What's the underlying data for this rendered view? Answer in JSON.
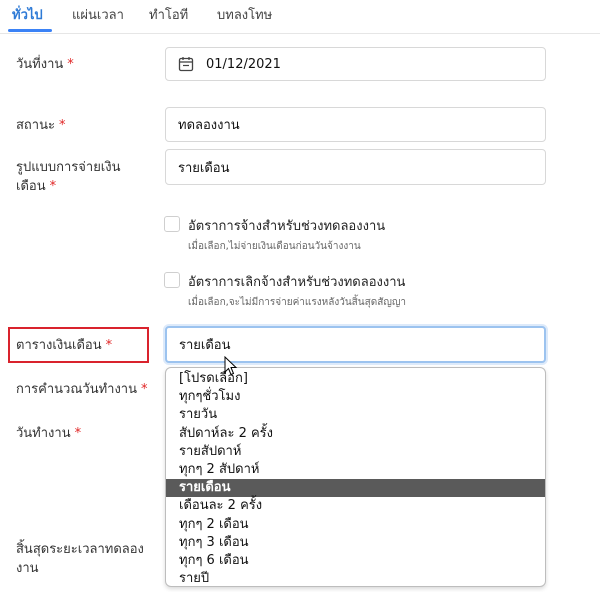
{
  "tabs": [
    {
      "label": "ทั่วไป",
      "active": true
    },
    {
      "label": "แผ่นเวลา",
      "active": false
    },
    {
      "label": "ทำโอที",
      "active": false
    },
    {
      "label": "บทลงโทษ",
      "active": false
    }
  ],
  "form": {
    "start_date_label": "วันที่งาน",
    "start_date_value": "01/12/2021",
    "status_label": "สถานะ",
    "status_value": "ทดลองงาน",
    "pay_format_label_line1": "รูปแบบการจ่ายเงิน",
    "pay_format_label_line2": "เดือน",
    "pay_format_value": "รายเดือน",
    "probation_rate_title": "อัตราการจ้างสำหรับช่วงทดลองงาน",
    "probation_rate_hint": "เมื่อเลือก,ไม่จ่ายเงินเดือนก่อนวันจ้างงาน",
    "termination_rate_title": "อัตราการเลิกจ้างสำหรับช่วงทดลองงาน",
    "termination_rate_hint": "เมื่อเลือก,จะไม่มีการจ่ายค่าแรงหลังวันสิ้นสุดสัญญา",
    "pay_schedule_label": "ตารางเงินเดือน",
    "pay_schedule_value": "รายเดือน",
    "workday_calc_label": "การคำนวณวันทำงาน",
    "workdays_label": "วันทำงาน",
    "probation_end_label_line1": "สิ้นสุดระยะเวลาทดลอง",
    "probation_end_label_line2": "งาน",
    "required_mark": "*"
  },
  "dropdown": {
    "options": [
      "[โปรดเลือก]",
      "ทุกๆชั่วโมง",
      "รายวัน",
      "สัปดาห์ละ 2 ครั้ง",
      "รายสัปดาห์",
      "ทุกๆ 2 สัปดาห์",
      "รายเดือน",
      "เดือนละ 2 ครั้ง",
      "ทุกๆ 2 เดือน",
      "ทุกๆ 3 เดือน",
      "ทุกๆ 6 เดือน",
      "รายปี"
    ],
    "selected": "รายเดือน"
  },
  "colors": {
    "accent": "#3b82f6",
    "required": "#e02424",
    "highlight_box": "#d9232d",
    "selected_option_bg": "#5a5a5a"
  },
  "icons": [
    "calendar-icon",
    "mouse-cursor-icon"
  ]
}
